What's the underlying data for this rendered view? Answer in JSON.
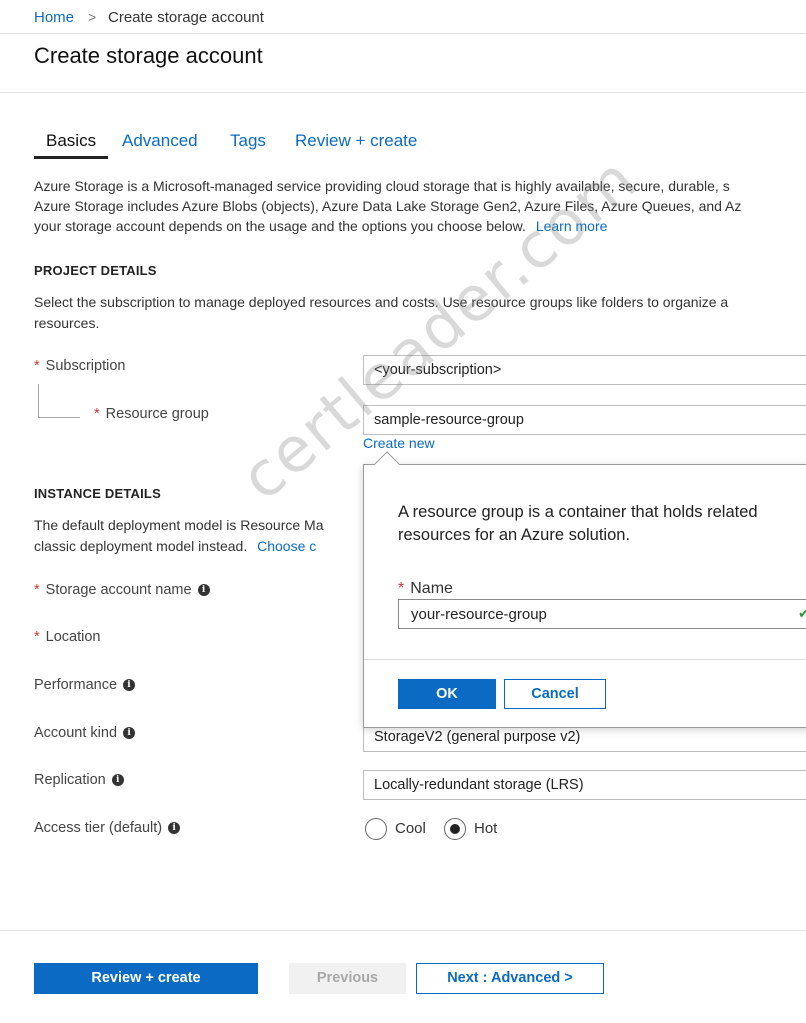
{
  "breadcrumb": {
    "home": "Home",
    "separator": ">",
    "current": "Create storage account"
  },
  "page_title": "Create storage account",
  "tabs": [
    {
      "label": "Basics",
      "active": true
    },
    {
      "label": "Advanced",
      "active": false
    },
    {
      "label": "Tags",
      "active": false
    },
    {
      "label": "Review + create",
      "active": false
    }
  ],
  "intro": {
    "line1": "Azure Storage is a Microsoft-managed service providing cloud storage that is highly available, secure, durable, s",
    "line2": "Azure Storage includes Azure Blobs (objects), Azure Data Lake Storage Gen2, Azure Files, Azure Queues, and Az",
    "line3": "your storage account depends on the usage and the options you choose below.",
    "learn_more": "Learn more"
  },
  "project_details": {
    "heading": "PROJECT DETAILS",
    "line1": "Select the subscription to manage deployed resources and costs. Use resource groups like folders to organize a",
    "line2": "resources.",
    "subscription_label": "Subscription",
    "subscription_value": "<your-subscription>",
    "resource_group_label": "Resource group",
    "resource_group_value": "sample-resource-group",
    "create_new": "Create new"
  },
  "instance_details": {
    "heading": "INSTANCE DETAILS",
    "line1": "The default deployment model is Resource Ma",
    "line2": "classic deployment model instead.",
    "choose_link": "Choose c",
    "storage_account_name_label": "Storage account name",
    "location_label": "Location",
    "performance_label": "Performance",
    "account_kind_label": "Account kind",
    "account_kind_value": "StorageV2 (general purpose v2)",
    "replication_label": "Replication",
    "replication_value": "Locally-redundant storage (LRS)",
    "access_tier_label": "Access tier (default)",
    "access_tier_options": [
      {
        "label": "Cool",
        "checked": false
      },
      {
        "label": "Hot",
        "checked": true
      }
    ]
  },
  "popup": {
    "description": "A resource group is a container that holds related resources for an Azure solution.",
    "name_label": "Name",
    "name_value": "your-resource-group",
    "ok": "OK",
    "cancel": "Cancel"
  },
  "footer": {
    "review_create": "Review + create",
    "previous": "Previous",
    "next": "Next : Advanced >"
  },
  "watermark": "certleader.com",
  "colors": {
    "accent": "#0b6bc4",
    "required": "#d13438",
    "valid": "#2e9c3a"
  }
}
